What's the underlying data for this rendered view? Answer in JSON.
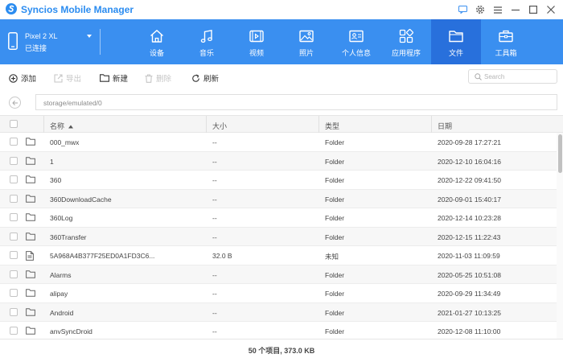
{
  "app": {
    "title": "Syncios Mobile Manager"
  },
  "colors": {
    "accent": "#3a8ff0",
    "accent_active": "#2870dc",
    "row_alt": "#f7f7f7"
  },
  "window_controls": [
    "message-icon",
    "settings-icon",
    "menu-icon",
    "minimize-icon",
    "maximize-icon",
    "close-icon"
  ],
  "device": {
    "name": "Pixel 2 XL",
    "status": "已连接"
  },
  "nav": [
    {
      "label": "设备",
      "icon": "home-icon"
    },
    {
      "label": "音乐",
      "icon": "music-icon"
    },
    {
      "label": "视频",
      "icon": "video-icon"
    },
    {
      "label": "照片",
      "icon": "photo-icon"
    },
    {
      "label": "个人信息",
      "icon": "contact-card-icon"
    },
    {
      "label": "应用程序",
      "icon": "apps-icon"
    },
    {
      "label": "文件",
      "icon": "folder-icon",
      "active": true
    },
    {
      "label": "工具箱",
      "icon": "toolbox-icon"
    }
  ],
  "actions": {
    "add": "添加",
    "export": "导出",
    "new": "新建",
    "delete": "删除",
    "refresh": "刷新"
  },
  "search": {
    "placeholder": "Search"
  },
  "path": {
    "value": "storage/emulated/0"
  },
  "table": {
    "columns": {
      "name": "名称",
      "size": "大小",
      "type": "类型",
      "date": "日期"
    },
    "sort": {
      "column": "name",
      "direction": "ascending"
    },
    "rows": [
      {
        "name": "000_mwx",
        "size": "--",
        "type": "Folder",
        "date": "2020-09-28 17:27:21",
        "icon": "folder-icon"
      },
      {
        "name": "1",
        "size": "--",
        "type": "Folder",
        "date": "2020-12-10 16:04:16",
        "icon": "folder-icon"
      },
      {
        "name": "360",
        "size": "--",
        "type": "Folder",
        "date": "2020-12-22 09:41:50",
        "icon": "folder-icon"
      },
      {
        "name": "360DownloadCache",
        "size": "--",
        "type": "Folder",
        "date": "2020-09-01 15:40:17",
        "icon": "folder-icon"
      },
      {
        "name": "360Log",
        "size": "--",
        "type": "Folder",
        "date": "2020-12-14 10:23:28",
        "icon": "folder-icon"
      },
      {
        "name": "360Transfer",
        "size": "--",
        "type": "Folder",
        "date": "2020-12-15 11:22:43",
        "icon": "folder-icon"
      },
      {
        "name": "5A968A4B377F25ED0A1FD3C6...",
        "size": "32.0 B",
        "type": "未知",
        "date": "2020-11-03 11:09:59",
        "icon": "file-icon"
      },
      {
        "name": "Alarms",
        "size": "--",
        "type": "Folder",
        "date": "2020-05-25 10:51:08",
        "icon": "folder-icon"
      },
      {
        "name": "alipay",
        "size": "--",
        "type": "Folder",
        "date": "2020-09-29 11:34:49",
        "icon": "folder-icon"
      },
      {
        "name": "Android",
        "size": "--",
        "type": "Folder",
        "date": "2021-01-27 10:13:25",
        "icon": "folder-icon"
      },
      {
        "name": "anvSyncDroid",
        "size": "--",
        "type": "Folder",
        "date": "2020-12-08 11:10:00",
        "icon": "folder-icon"
      }
    ]
  },
  "footer": {
    "summary": "50 个项目, 373.0 KB"
  }
}
